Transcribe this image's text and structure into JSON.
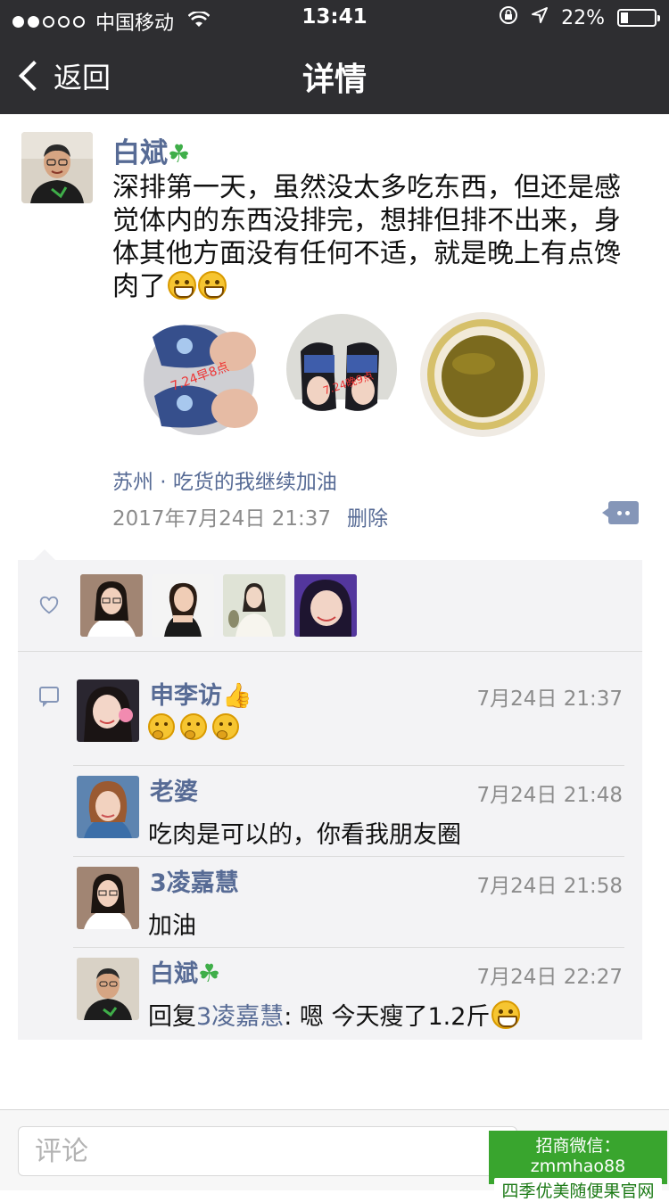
{
  "status_bar": {
    "carrier": "中国移动",
    "time": "13:41",
    "battery": "22%",
    "battery_fraction": 0.22,
    "signal_bars": 2
  },
  "nav": {
    "back_label": "返回",
    "title": "详情"
  },
  "post": {
    "author": "白斌",
    "author_emoji": "☘",
    "text": "深排第一天，虽然没太多吃东西，但还是感觉体内的东西没排完，想排但排不出来，身体其他方面没有任何不适，就是晚上有点馋肉了",
    "photo_captions": [
      "7.24早8点",
      "7.24晚9点"
    ],
    "location": "苏州 · 吃货的我继续加油",
    "timestamp": "2017年7月24日 21:37",
    "delete_label": "删除"
  },
  "likes": {
    "icon": "heart-icon",
    "count": 4
  },
  "comments": [
    {
      "name": "申李访",
      "name_emoji": "👍",
      "time": "7月24日 21:37",
      "text": "",
      "emoji_count": 3
    },
    {
      "name": "老婆",
      "time": "7月24日 21:48",
      "text": "吃肉是可以的，你看我朋友圈"
    },
    {
      "name": "3凌嘉慧",
      "time": "7月24日 21:58",
      "text": "加油"
    },
    {
      "name": "白斌",
      "name_emoji": "☘",
      "time": "7月24日 22:27",
      "reply_prefix": "回复",
      "reply_to": "3凌嘉慧",
      "text": ": 嗯 今天瘦了1.2斤"
    }
  ],
  "comment_input": {
    "placeholder": "评论"
  },
  "watermark": {
    "line1": "招商微信：zmmhao88",
    "line2": "四季优美随便果官网"
  },
  "colors": {
    "nav_bg": "#2e2e31",
    "link": "#576b95",
    "panel_bg": "#f3f3f5",
    "watermark": "#39a52e"
  }
}
